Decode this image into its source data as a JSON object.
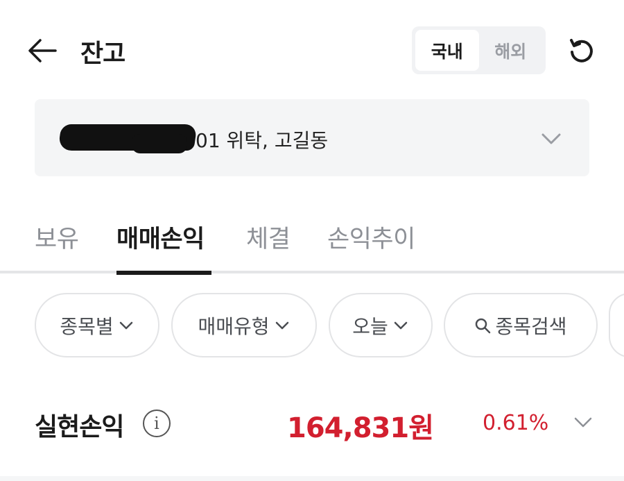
{
  "header": {
    "title": "잔고",
    "segments": [
      {
        "label": "국내",
        "active": true
      },
      {
        "label": "해외",
        "active": false
      }
    ]
  },
  "account": {
    "visible_text": "01 위탁, 고길동"
  },
  "tabs": [
    {
      "label": "보유",
      "active": false
    },
    {
      "label": "매매손익",
      "active": true
    },
    {
      "label": "체결",
      "active": false
    },
    {
      "label": "손익추이",
      "active": false
    }
  ],
  "filters": [
    {
      "label": "종목별"
    },
    {
      "label": "매매유형"
    },
    {
      "label": "오늘"
    },
    {
      "label": "종목검색"
    }
  ],
  "realized": {
    "label": "실현손익",
    "amount": "164,831원",
    "rate": "0.61%"
  },
  "colors": {
    "profit_red": "#d21f2f",
    "text_primary": "#1b1b1b",
    "text_secondary": "#8d9096",
    "panel_bg": "#f4f5f6"
  }
}
